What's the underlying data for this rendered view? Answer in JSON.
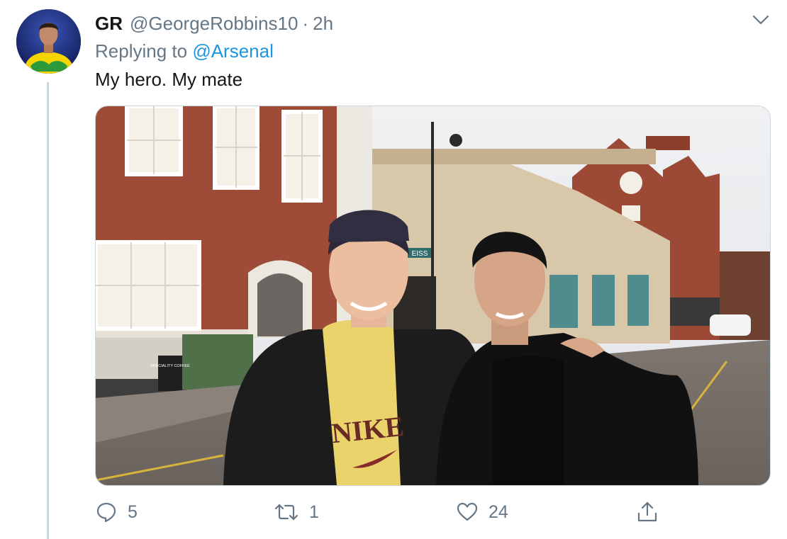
{
  "tweet": {
    "display_name": "GR",
    "handle": "@GeorgeRobbins10",
    "separator": "·",
    "time": "2h",
    "replying_prefix": "Replying to",
    "replying_handle": "@Arsenal",
    "text": "My hero. My mate"
  },
  "media": {
    "shop_sign": "EISS",
    "board_text": "SPECIALITY COFFEE"
  },
  "actions": {
    "reply_count": "5",
    "retweet_count": "1",
    "like_count": "24"
  },
  "icons": [
    "chevron-down-icon",
    "reply-icon",
    "retweet-icon",
    "like-icon",
    "share-icon"
  ],
  "colors": {
    "link": "#1b95e0",
    "secondary_text": "#657786",
    "thread_line": "#ccd6dd"
  }
}
